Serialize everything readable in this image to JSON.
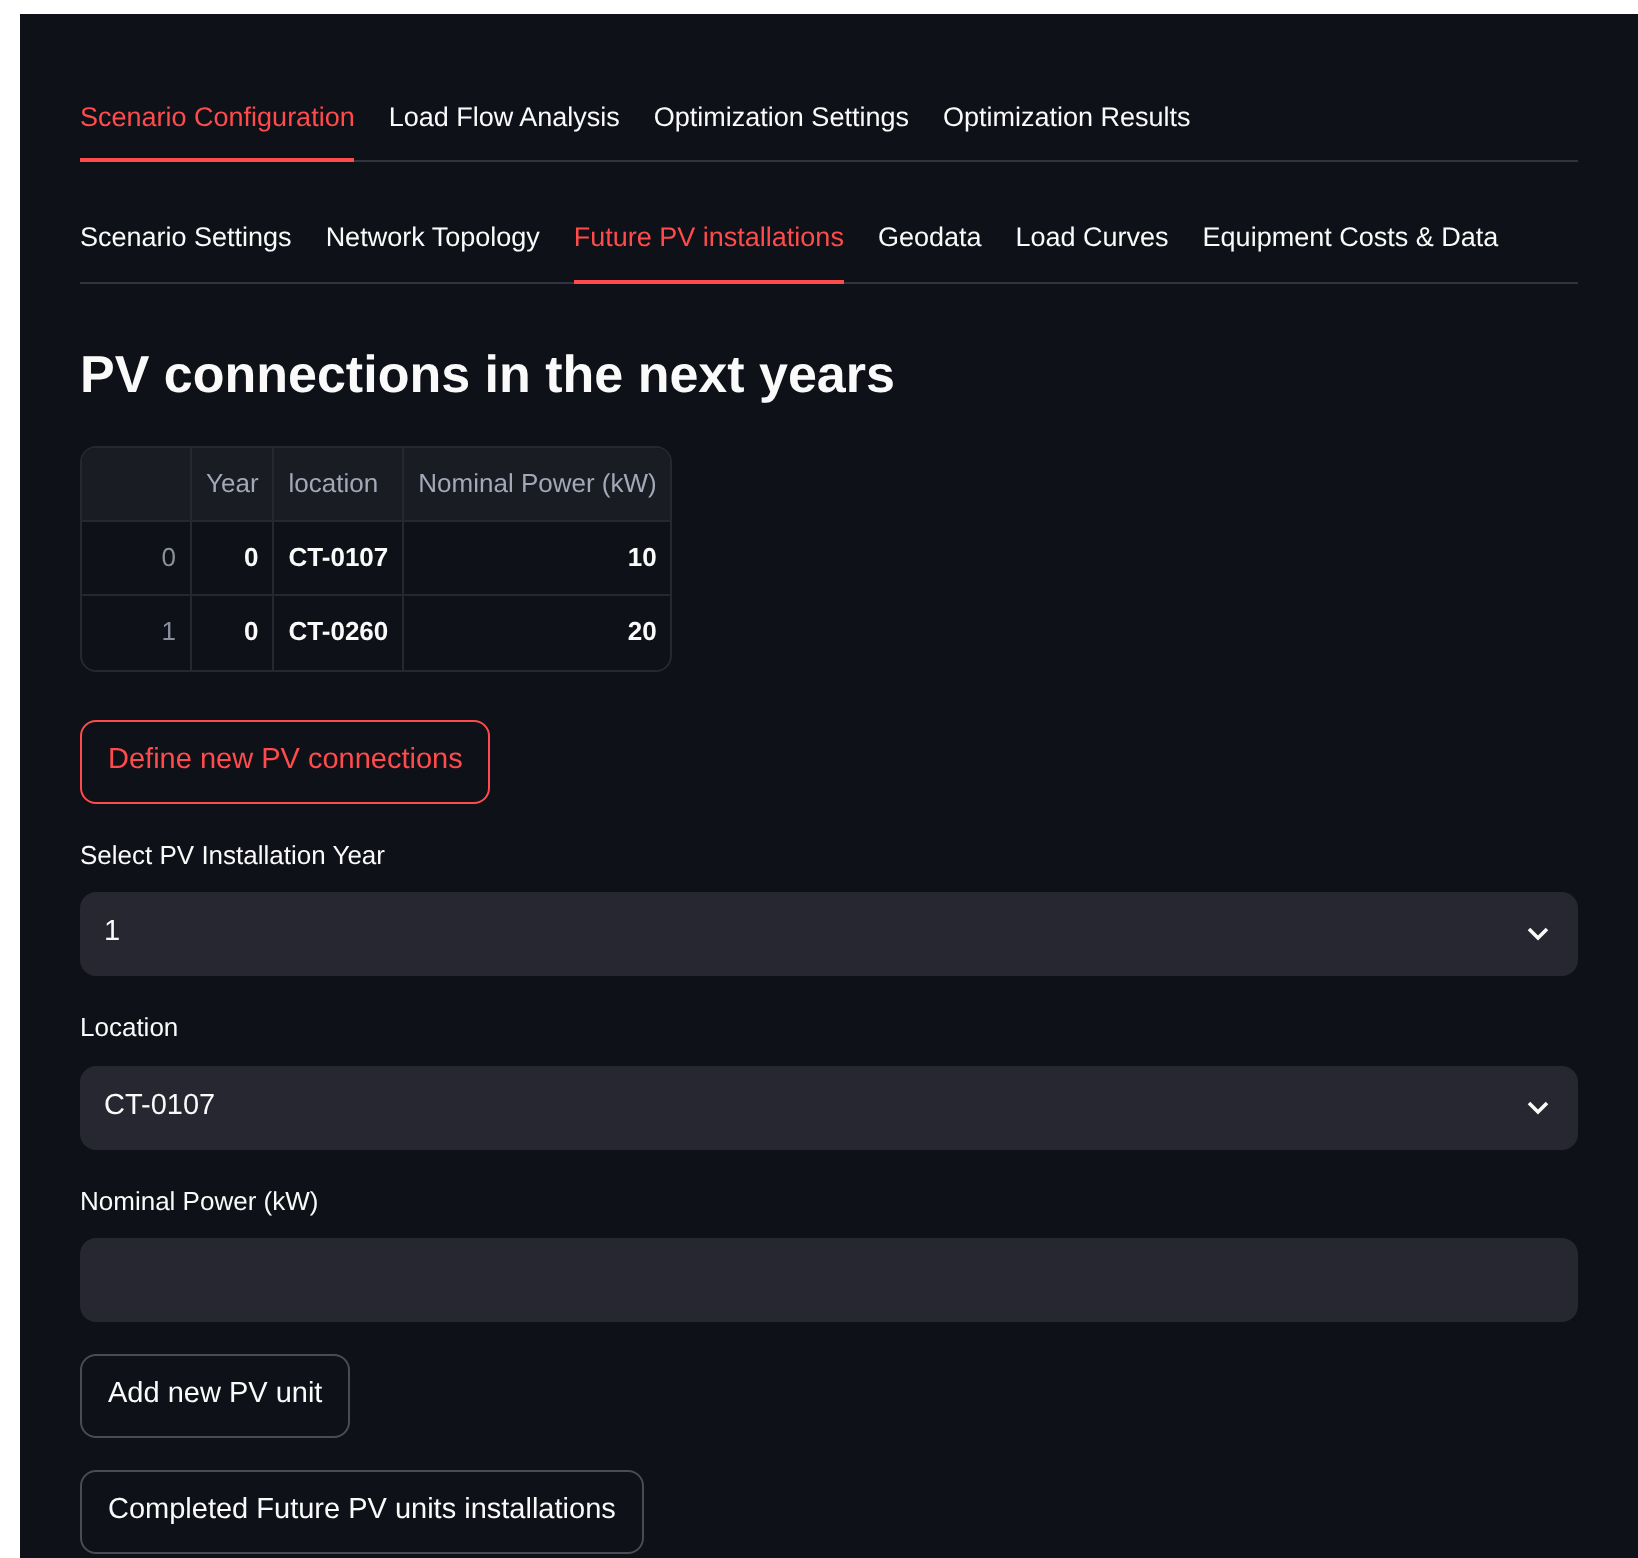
{
  "main_tabs": [
    {
      "label": "Scenario Configuration",
      "selected": true
    },
    {
      "label": "Load Flow Analysis",
      "selected": false
    },
    {
      "label": "Optimization Settings",
      "selected": false
    },
    {
      "label": "Optimization Results",
      "selected": false
    }
  ],
  "sub_tabs": [
    {
      "label": "Scenario Settings",
      "selected": false
    },
    {
      "label": "Network Topology",
      "selected": false
    },
    {
      "label": "Future PV installations",
      "selected": true
    },
    {
      "label": "Geodata",
      "selected": false
    },
    {
      "label": "Load Curves",
      "selected": false
    },
    {
      "label": "Equipment Costs & Data",
      "selected": false
    }
  ],
  "heading": "PV connections in the next years",
  "table": {
    "columns": [
      "Year",
      "location",
      "Nominal Power (kW)"
    ],
    "rows": [
      {
        "index": "0",
        "cells": [
          "0",
          "CT-0107",
          "10"
        ]
      },
      {
        "index": "1",
        "cells": [
          "0",
          "CT-0260",
          "20"
        ]
      }
    ]
  },
  "define_button": "Define new PV connections",
  "fields": [
    {
      "kind": "select",
      "label": "Select PV Installation Year",
      "value": "1"
    },
    {
      "kind": "select",
      "label": "Location",
      "value": "CT-0107"
    },
    {
      "kind": "number",
      "label": "Nominal Power (kW)"
    }
  ],
  "buttons": [
    "Add new PV unit",
    "Completed Future PV units installations"
  ]
}
